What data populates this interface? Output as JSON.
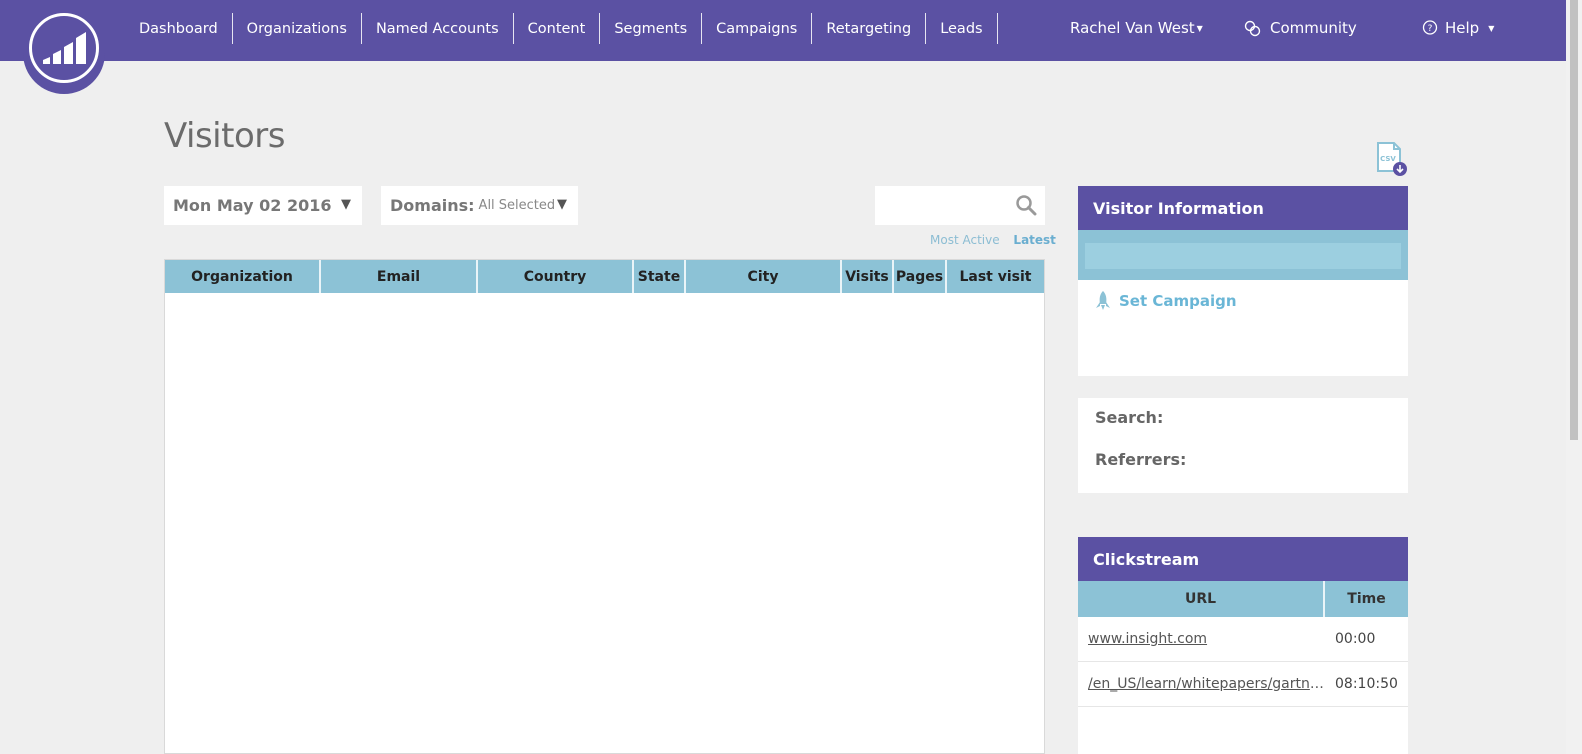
{
  "nav": {
    "items": [
      {
        "label": "Dashboard"
      },
      {
        "label": "Organizations"
      },
      {
        "label": "Named Accounts"
      },
      {
        "label": "Content"
      },
      {
        "label": "Segments"
      },
      {
        "label": "Campaigns"
      },
      {
        "label": "Retargeting"
      },
      {
        "label": "Leads"
      }
    ],
    "user": "Rachel Van West",
    "community": "Community",
    "help": "Help"
  },
  "page": {
    "title": "Visitors"
  },
  "filters": {
    "date": "Mon May 02 2016",
    "domains_label": "Domains:",
    "domains_value": "All Selected",
    "search_value": ""
  },
  "sort": {
    "most_active": "Most Active",
    "latest": "Latest"
  },
  "table": {
    "columns": [
      "Organization",
      "Email",
      "Country",
      "State",
      "City",
      "Visits",
      "Pages",
      "Last visit"
    ],
    "rows": []
  },
  "visitor_info": {
    "title": "Visitor Information",
    "set_campaign": "Set Campaign",
    "search_label": "Search:",
    "referrers_label": "Referrers:"
  },
  "clickstream": {
    "title": "Clickstream",
    "columns": [
      "URL",
      "Time"
    ],
    "rows": [
      {
        "url": "www.insight.com",
        "time": "00:00"
      },
      {
        "url": "/en_US/learn/whitepapers/gartne...",
        "time": "08:10:50"
      }
    ]
  },
  "colors": {
    "brand": "#5b51a3",
    "table_header": "#8cc2d6",
    "link": "#6ab6d6"
  },
  "icons": {
    "logo": "marketo-logo-icon",
    "community": "community-icon",
    "help": "help-icon",
    "csv": "csv-download-icon",
    "search": "search-icon",
    "campaign": "rocket-icon"
  }
}
